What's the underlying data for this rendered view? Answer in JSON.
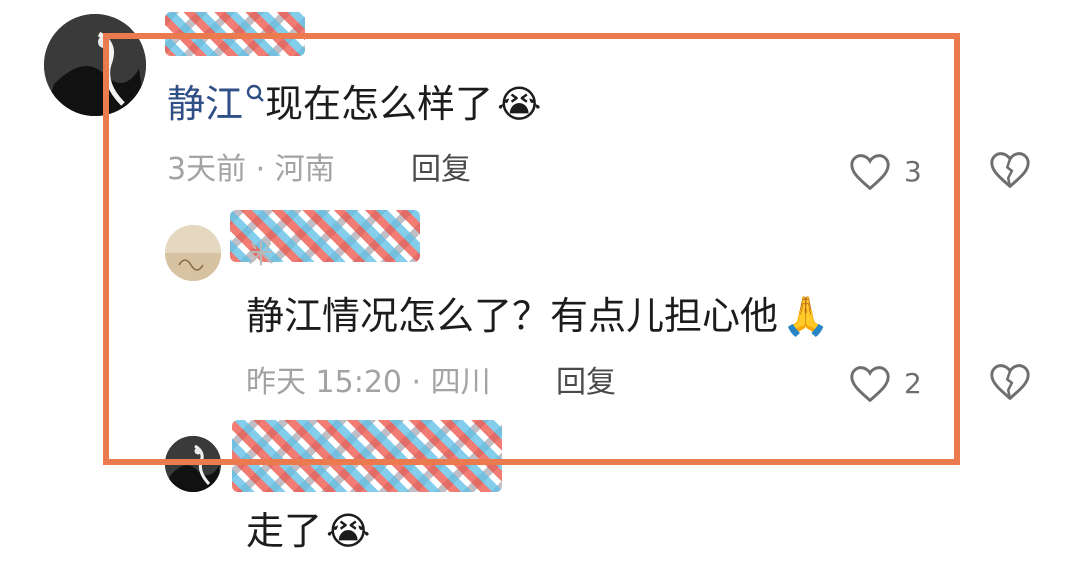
{
  "comment1": {
    "mention": "静江",
    "text": "现在怎么样了",
    "emoji": "😭",
    "time_loc": "3天前 · 河南",
    "reply_label": "回复",
    "likes": "3"
  },
  "reply1": {
    "name_fragment": "米",
    "text": "静江情况怎么了？有点儿担心他",
    "emoji": "🙏",
    "time_loc": "昨天 15:20 · 四川",
    "reply_label": "回复",
    "likes": "2"
  },
  "reply2": {
    "text": "走了",
    "emoji": "😭"
  },
  "icons": {
    "like": "heart-outline-icon",
    "dislike": "broken-heart-icon",
    "mention_search": "search-icon"
  },
  "colors": {
    "highlight_frame": "#ec7a4f",
    "mention_link": "#2f4f86"
  }
}
